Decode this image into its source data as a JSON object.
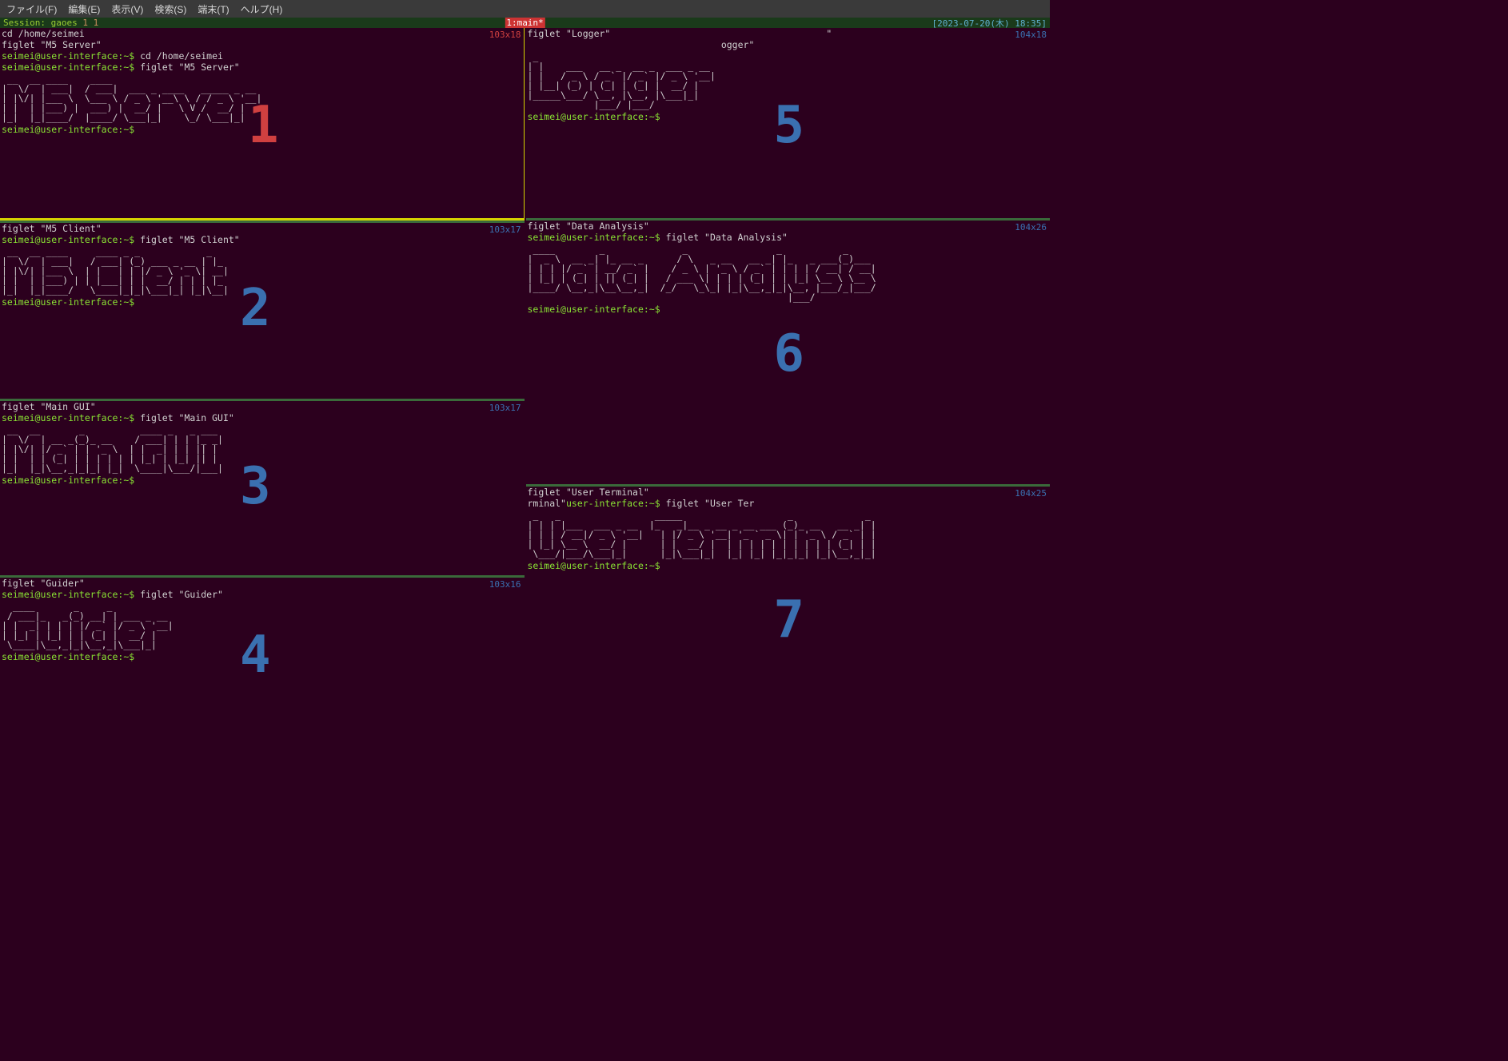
{
  "menubar": {
    "file": "ファイル(F)",
    "edit": "編集(E)",
    "view": "表示(V)",
    "search": "検索(S)",
    "terminal": "端末(T)",
    "help": "ヘルプ(H)"
  },
  "statusbar": {
    "session_label": "Session: ",
    "session_name": "gaoes",
    "nums": " 1 1",
    "center": "1:main*",
    "right": "[2023-07-20(木) 18:35]"
  },
  "panes": {
    "p1": {
      "dim": "103x18",
      "line1": "cd /home/seimei",
      "line2": "figlet \"M5 Server\"",
      "prompt1": "seimei@user-interface:~$ ",
      "cmd1": "cd /home/seimei",
      "prompt2": "seimei@user-interface:~$ ",
      "cmd2": "figlet \"M5 Server\"",
      "ascii": " __  __ ____    ____                           \n|  \\/  | ___|  / ___|  ___ _ ____   _____ _ __ \n| |\\/| |___ \\  \\___ \\ / _ \\ '__\\ \\ / / _ \\ '__|\n| |  | |___) |  ___) |  __/ |   \\ V /  __/ |   \n|_|  |_|____/  |____/ \\___|_|    \\_/ \\___|_|   ",
      "prompt3": "seimei@user-interface:~$ ",
      "num": "1"
    },
    "p2": {
      "dim": "103x17",
      "line1": "figlet \"M5 Client\"",
      "prompt1": "seimei@user-interface:~$ ",
      "cmd1": "figlet \"M5 Client\"",
      "ascii": " __  __ ____     ____ _ _            _   \n|  \\/  | ___|   / ___| (_) ___ _ __ | |_ \n| |\\/| |___ \\  | |   | | |/ _ \\ '_ \\| __|\n| |  | |___) | | |___| | |  __/ | | | |_ \n|_|  |_|____/   \\____|_|_|\\___|_| |_|\\__|",
      "prompt2": "seimei@user-interface:~$ ",
      "num": "2"
    },
    "p3": {
      "dim": "103x17",
      "line1": "figlet \"Main GUI\"",
      "prompt1": "seimei@user-interface:~$ ",
      "cmd1": "figlet \"Main GUI\"",
      "ascii": " __  __       _          ____ _   _ ___ \n|  \\/  | __ _(_)_ __    / ___| | | |_ _|\n| |\\/| |/ _` | | '_ \\  | |  _| | | || | \n| |  | | (_| | | | | | | |_| | |_| || | \n|_|  |_|\\__,_|_|_| |_|  \\____|\\___/|___|",
      "prompt2": "seimei@user-interface:~$ ",
      "num": "3"
    },
    "p4": {
      "dim": "103x16",
      "line1": "figlet \"Guider\"",
      "prompt1": "seimei@user-interface:~$ ",
      "cmd1": "figlet \"Guider\"",
      "ascii": "  ____       _     _           \n / ___|_   _(_) __| | ___ _ __ \n| |  _| | | | |/ _` |/ _ \\ '__|\n| |_| | |_| | | (_| |  __/ |   \n \\____|\\__,_|_|\\__,_|\\___|_|   ",
      "prompt2": "seimei@user-interface:~$ ",
      "num": "4"
    },
    "p5": {
      "dim": "104x18",
      "line1": "figlet \"Logger\"",
      "line1b": "                                       \"",
      "line2": "                                   ogger\"",
      "ascii": " _                                \n| |    ___   __ _  __ _  ___ _ __ \n| |   / _ \\ / _` |/ _` |/ _ \\ '__|\n| |__| (_) | (_| | (_| |  __/ |   \n|_____\\___/ \\__, |\\__, |\\___|_|   \n            |___/ |___/           ",
      "prompt1": "seimei@user-interface:~$ ",
      "num": "5"
    },
    "p6": {
      "dim": "104x26",
      "line1": "figlet \"Data Analysis\"",
      "prompt1": "seimei@user-interface:~$ ",
      "cmd1": "figlet \"Data Analysis\"",
      "ascii": " ____        _              _                _           _     \n|  _ \\  __ _| |_ __ _      / \\   _ __   __ _| |_   _ ___(_)___ \n| | | |/ _` | __/ _` |    / _ \\ | '_ \\ / _` | | | | / __| / __|\n| |_| | (_| | || (_| |   / ___ \\| | | | (_| | | |_| \\__ \\ \\__ \\\n|____/ \\__,_|\\__\\__,_|  /_/   \\_\\_| |_|\\__,_|_|\\__, |___/_|___/\n                                               |___/           ",
      "prompt2": "seimei@user-interface:~$ ",
      "num": "6"
    },
    "p7": {
      "dim": "104x25",
      "line1": "figlet \"User Terminal\"",
      "prompt1a": "rminal\"",
      "prompt1b": "user-interface:~$ ",
      "cmd1": "figlet \"User Ter",
      "ascii": " _   _                 _____                   _             _ \n| | | |___  ___ _ __  |_   _|__ _ __ _ __ ___ (_)_ __   __ _| |\n| | | / __|/ _ \\ '__|   | |/ _ \\ '__| '_ ` _ \\| | '_ \\ / _` | |\n| |_| \\__ \\  __/ |      | |  __/ |  | | | | | | | | | | (_| | |\n \\___/|___/\\___|_|      |_|\\___|_|  |_| |_| |_|_|_| |_|\\__,_|_|",
      "prompt2": "seimei@user-interface:~$ ",
      "num": "7"
    }
  }
}
